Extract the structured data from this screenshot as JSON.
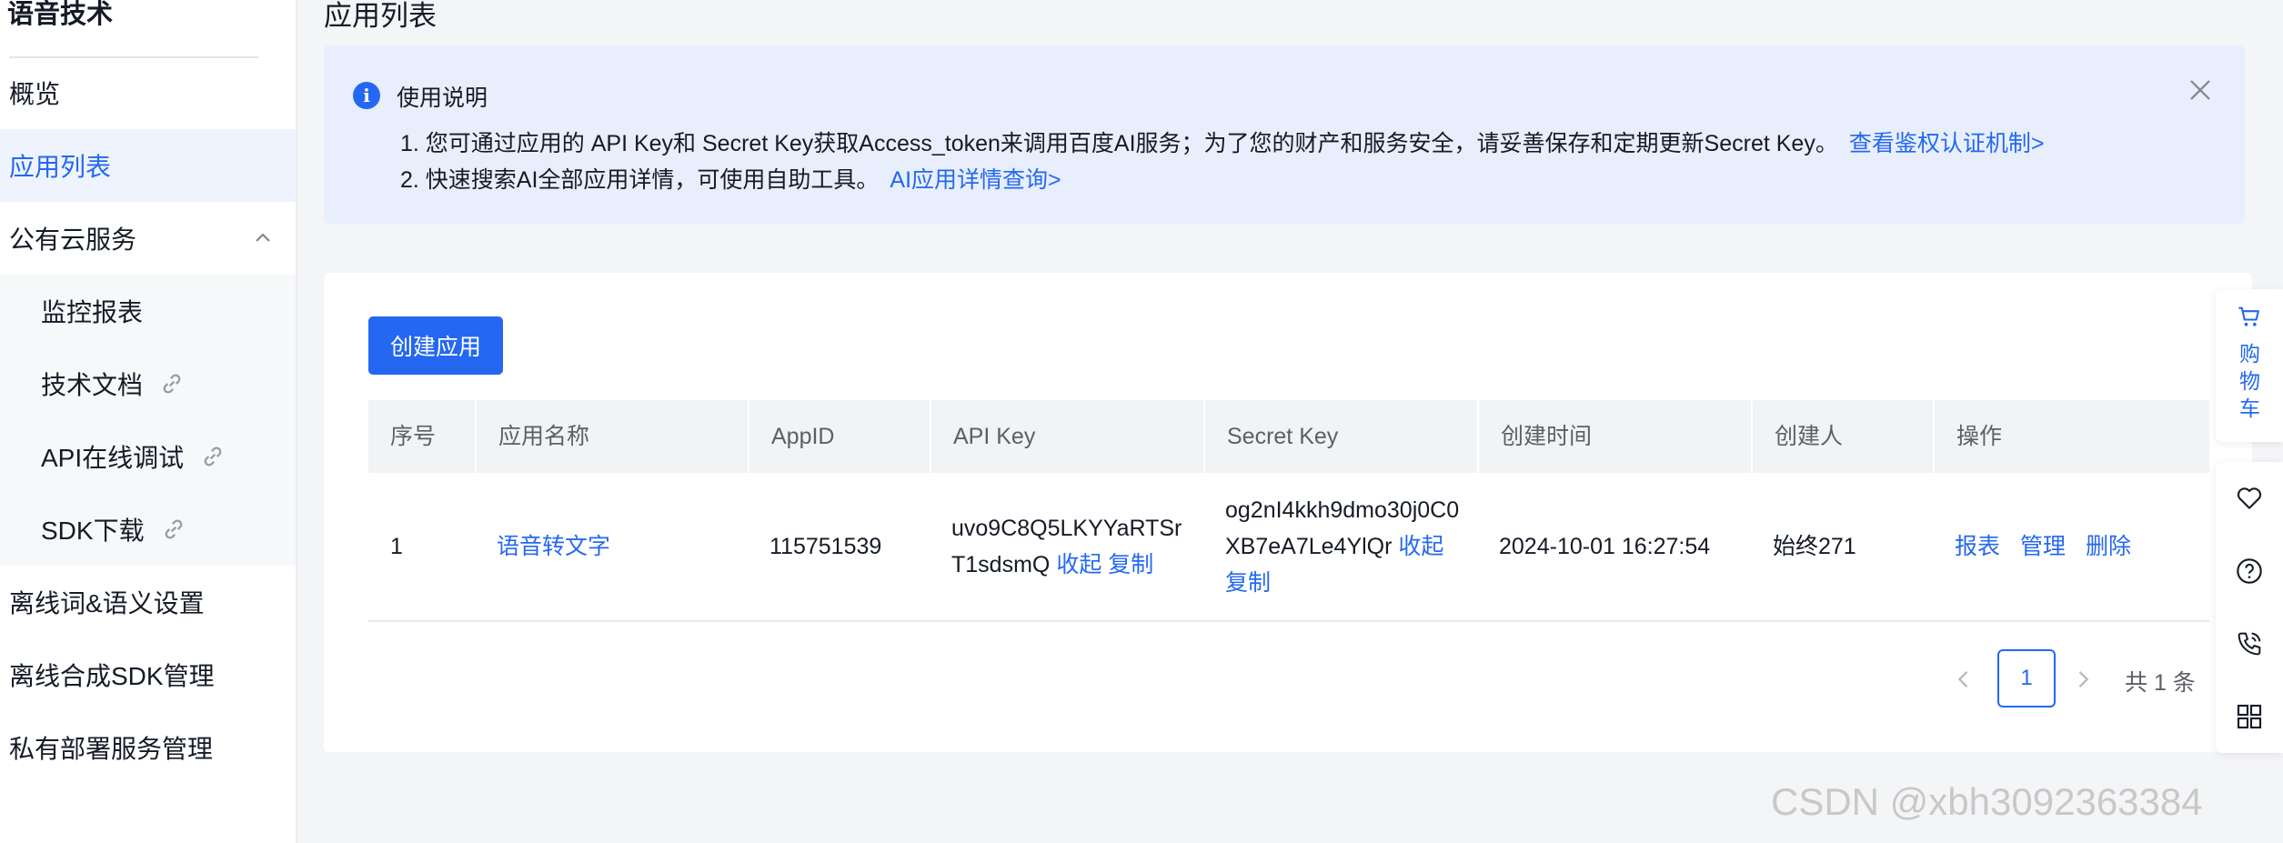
{
  "sidebar": {
    "product_title": "语音技术",
    "items": [
      {
        "label": "概览"
      },
      {
        "label": "应用列表"
      },
      {
        "label": "公有云服务"
      },
      {
        "label": "监控报表"
      },
      {
        "label": "技术文档"
      },
      {
        "label": "API在线调试"
      },
      {
        "label": "SDK下载"
      },
      {
        "label": "离线词&语义设置"
      },
      {
        "label": "离线合成SDK管理"
      },
      {
        "label": "私有部署服务管理"
      }
    ]
  },
  "page": {
    "title": "应用列表"
  },
  "notice": {
    "title": "使用说明",
    "line1": "1. 您可通过应用的 API Key和 Secret Key获取Access_token来调用百度AI服务；为了您的财产和服务安全，请妥善保存和定期更新Secret Key。",
    "line1_link": "查看鉴权认证机制>",
    "line2": "2. 快速搜索AI全部应用详情，可使用自助工具。",
    "line2_link": "AI应用详情查询>"
  },
  "toolbar": {
    "create_label": "创建应用"
  },
  "table": {
    "headers": [
      "序号",
      "应用名称",
      "AppID",
      "API Key",
      "Secret Key",
      "创建时间",
      "创建人",
      "操作"
    ],
    "rows": [
      {
        "index": "1",
        "name": "语音转文字",
        "app_id": "115751539",
        "api_key": "uvo9C8Q5LKYYaRTSrT1sdsmQ",
        "api_key_collapse": "收起",
        "api_key_copy": "复制",
        "secret_key": "og2nI4kkh9dmo30j0C0XB7eA7Le4YlQr",
        "secret_key_collapse": "收起",
        "secret_key_copy": "复制",
        "created_at": "2024-10-01 16:27:54",
        "creator": "始终271",
        "ops": [
          "报表",
          "管理",
          "删除"
        ]
      }
    ]
  },
  "pagination": {
    "current_page": "1",
    "total_text": "共 1 条"
  },
  "float_bar": {
    "cart_label": "购物车"
  },
  "watermark": "CSDN @xbh3092363384",
  "colors": {
    "accent": "#2468f2",
    "notice_bg": "#e8eefb",
    "active_nav_bg": "#eef3fd",
    "page_bg": "#f4f5f7"
  }
}
